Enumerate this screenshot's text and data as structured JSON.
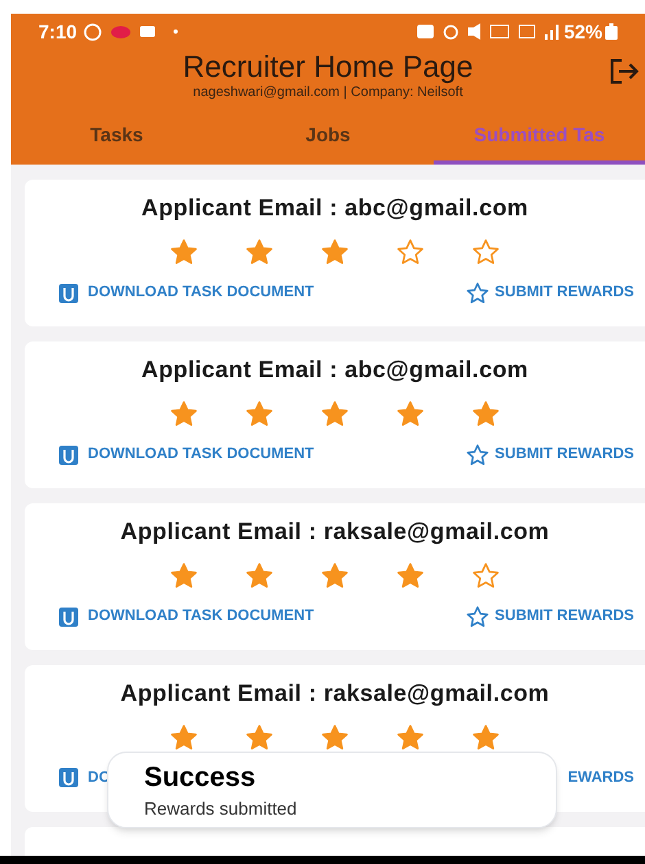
{
  "status_bar": {
    "time": "7:10",
    "battery": "52%"
  },
  "header": {
    "title": "Recruiter Home Page",
    "subtitle": "nageshwari@gmail.com | Company: Neilsoft"
  },
  "tabs": [
    {
      "label": "Tasks",
      "selected": false
    },
    {
      "label": "Jobs",
      "selected": false
    },
    {
      "label": "Submitted Tas",
      "selected": true
    }
  ],
  "submissions": [
    {
      "title": "Applicant Email : abc@gmail.com",
      "stars": 3,
      "download_label": "DOWNLOAD TASK DOCUMENT",
      "submit_label": "SUBMIT REWARDS"
    },
    {
      "title": "Applicant Email : abc@gmail.com",
      "stars": 5,
      "download_label": "DOWNLOAD TASK DOCUMENT",
      "submit_label": "SUBMIT REWARDS"
    },
    {
      "title": "Applicant Email : raksale@gmail.com",
      "stars": 4,
      "download_label": "DOWNLOAD TASK DOCUMENT",
      "submit_label": "SUBMIT REWARDS"
    },
    {
      "title": "Applicant Email : raksale@gmail.com",
      "stars": 5,
      "download_label": "DO",
      "submit_label": "EWARDS"
    }
  ],
  "toast": {
    "title": "Success",
    "message": "Rewards submitted"
  }
}
